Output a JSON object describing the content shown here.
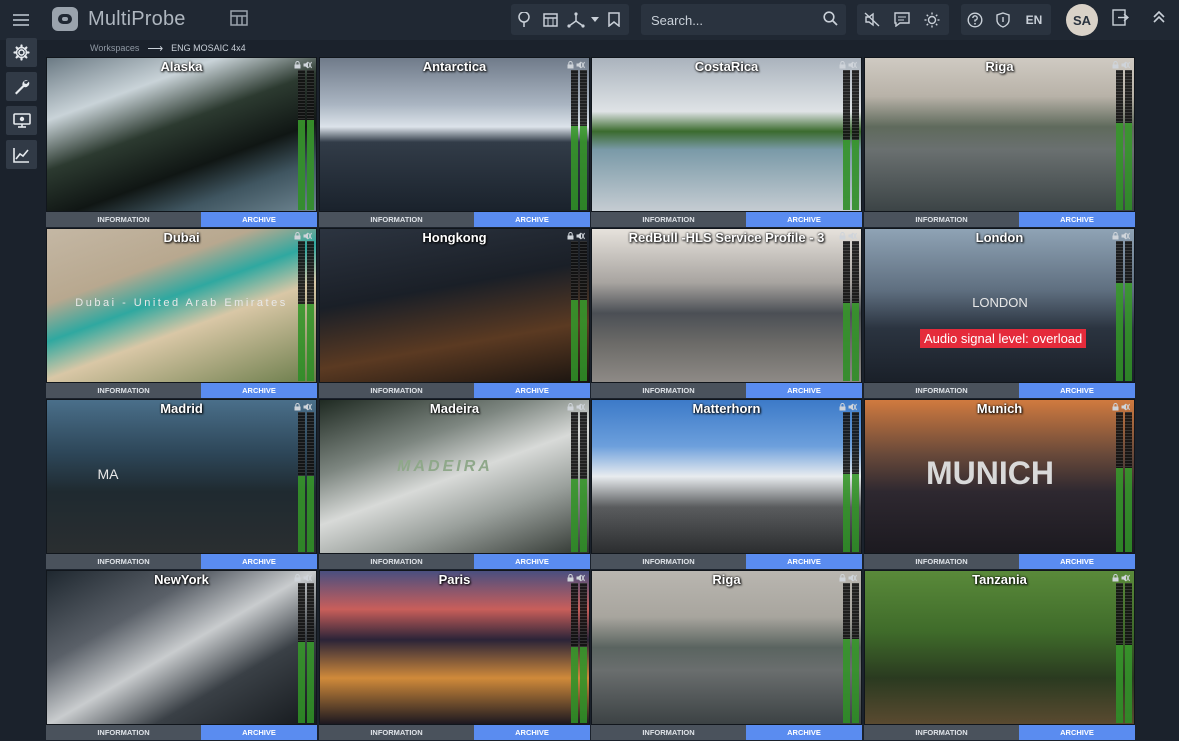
{
  "app": {
    "name": "MultiProbe"
  },
  "search": {
    "placeholder": "Search..."
  },
  "header": {
    "language": "EN",
    "avatar_initials": "SA"
  },
  "breadcrumb": {
    "parent": "Workspaces",
    "current": "ENG MOSAIC 4x4"
  },
  "tiles": [
    {
      "title": "Alaska",
      "info": "INFORMATION",
      "archive": "ARCHIVE",
      "bg": "linear-gradient(160deg,#6b7a84 0%,#c9d3d8 25%,#2c3a30 45%,#101614 65%,#3f5560 80%,#6e8591 100%)"
    },
    {
      "title": "Antarctica",
      "info": "INFORMATION",
      "archive": "ARCHIVE",
      "bg": "linear-gradient(180deg,#707b8a 0%,#a9b4c1 30%,#dce3ea 45%,#323c48 55%,#1a222c 100%)"
    },
    {
      "title": "CostaRica",
      "info": "INFORMATION",
      "archive": "ARCHIVE",
      "bg": "linear-gradient(180deg,#aab3bd 0%,#dfe3e6 35%,#3b6b2e 48%,#7a9aa8 60%,#c5ccd2 100%)"
    },
    {
      "title": "Riga",
      "info": "INFORMATION",
      "archive": "ARCHIVE",
      "bg": "linear-gradient(180deg,#cfcac2 0%,#b8b2a8 25%,#5f6a5c 45%,#6a7070 60%,#3c4446 100%)"
    },
    {
      "title": "Dubai",
      "info": "INFORMATION",
      "archive": "ARCHIVE",
      "bg": "linear-gradient(160deg,#c4b7a4 0%,#b8a88f 30%,#2fa8a0 45%,#d9c7a6 60%,#6b7d4b 100%)",
      "overlay": "Dubai - United Arab Emirates"
    },
    {
      "title": "Hongkong",
      "info": "INFORMATION",
      "archive": "ARCHIVE",
      "bg": "linear-gradient(170deg,#2c3440 0%,#1a1f27 40%,#5b3a22 70%,#1a1410 100%)"
    },
    {
      "title": "RedBull -HLS Service Profile - 3",
      "info": "INFORMATION",
      "archive": "ARCHIVE",
      "bg": "linear-gradient(180deg,#e6e2dc 0%,#a8a4a0 35%,#4b4f55 55%,#6c6b68 75%,#8e8a86 100%)"
    },
    {
      "title": "London",
      "info": "INFORMATION",
      "archive": "ARCHIVE",
      "bg": "linear-gradient(180deg,#8fa3b5 0%,#5f6f80 40%,#2b3440 65%,#1a2029 100%)",
      "overlay": "LONDON",
      "alert": "Audio signal level: overload"
    },
    {
      "title": "Madrid",
      "info": "INFORMATION",
      "archive": "ARCHIVE",
      "bg": "linear-gradient(180deg,#4a6f8a 0%,#2d4658 35%,#1f2a30 60%,#2a2e30 100%)",
      "overlay": "MA"
    },
    {
      "title": "Madeira",
      "info": "INFORMATION",
      "archive": "ARCHIVE",
      "bg": "linear-gradient(160deg,#1f2a22 0%,#7d8680 30%,#d8dad8 50%,#9aa09c 70%,#2f3530 100%)",
      "overlay": "MADEIRA"
    },
    {
      "title": "Matterhorn",
      "info": "INFORMATION",
      "archive": "ARCHIVE",
      "bg": "linear-gradient(180deg,#3c7ac8 0%,#6c9fdc 30%,#e8ecef 50%,#5a5c5e 70%,#2c2e30 100%)"
    },
    {
      "title": "Munich",
      "info": "INFORMATION",
      "archive": "ARCHIVE",
      "bg": "linear-gradient(180deg,#d07a3f 0%,#6a4a3a 35%,#2e2830 60%,#1c1a20 100%)",
      "overlay": "MUNICH"
    },
    {
      "title": "NewYork",
      "info": "INFORMATION",
      "archive": "ARCHIVE",
      "bg": "linear-gradient(150deg,#1f2830 0%,#5a6068 30%,#c9ccce 50%,#3a4046 70%,#15191d 100%)"
    },
    {
      "title": "Paris",
      "info": "INFORMATION",
      "archive": "ARCHIVE",
      "bg": "linear-gradient(180deg,#4a4f80 0%,#c95e5a 25%,#2b2438 45%,#d08a3a 70%,#1c1820 100%)"
    },
    {
      "title": "Riga",
      "info": "INFORMATION",
      "archive": "ARCHIVE",
      "bg": "linear-gradient(180deg,#b9b6b0 0%,#a8a59e 30%,#5a6460 50%,#6a6e6e 65%,#3c4244 100%)"
    },
    {
      "title": "Tanzania",
      "info": "INFORMATION",
      "archive": "ARCHIVE",
      "bg": "linear-gradient(180deg,#5a8a3a 0%,#3f6b2a 40%,#2a3a20 70%,#5a4a30 100%)"
    }
  ]
}
